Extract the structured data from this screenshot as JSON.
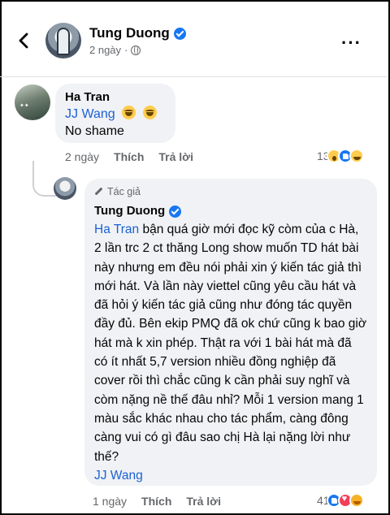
{
  "header": {
    "back_icon": "chevron-left-icon",
    "name": "Tung Duong",
    "time": "2 ngày",
    "audience_icon": "globe-icon",
    "more_label": "···"
  },
  "comment1": {
    "author": "Ha Tran",
    "mention": "JJ Wang",
    "emoji_icons": [
      "laughing-tears-icon",
      "laughing-tears-icon"
    ],
    "text": "No shame",
    "time": "2 ngày",
    "like_label": "Thích",
    "reply_label": "Trả lời",
    "reaction_count": "13",
    "reactions": [
      "wow",
      "like",
      "haha"
    ]
  },
  "reply": {
    "badge": "Tác giả",
    "author": "Tung Duong",
    "mention": "Ha Tran",
    "body": " bận quá giờ mới đọc kỹ còm của c Hà, 2 lần trc 2 ct thăng Long show muốn TD hát bài này nhưng em đều nói phải xin ý kiến tác giả thì mới hát. Và lần này viettel cũng yêu cầu hát và đã hỏi ý kiến tác giả cũng như đóng tác quyền đầy đủ. Bên ekip PMQ đã ok chứ cũng k bao giờ hát mà k xin phép. Thật ra với 1 bài hát mà đã có ít nhất 5,7 version nhiều đồng nghiệp đã cover rồi thì chắc cũng k cần phải suy nghĩ và còm nặng nề thế đâu nhỉ? Mỗi 1 version mang 1 màu sắc khác nhau cho tác phẩm, càng đông càng vui có gì đâu sao chị Hà lại nặng lời như thế?",
    "mention_end": "JJ Wang",
    "time": "1 ngày",
    "like_label": "Thích",
    "reply_label": "Trả lời",
    "reaction_count": "41",
    "reactions": [
      "like",
      "love",
      "care"
    ]
  },
  "colors": {
    "accent": "#1877f2",
    "mention": "#1b61d4",
    "bubble": "#f0f2f5",
    "meta": "#65676b"
  }
}
